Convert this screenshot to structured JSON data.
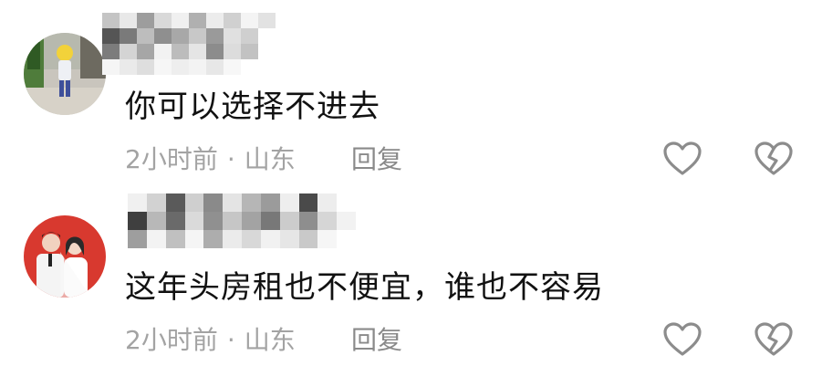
{
  "comments": [
    {
      "username": "",
      "text": "你可以选择不进去",
      "time": "2小时前",
      "separator": "·",
      "location": "山东",
      "reply_label": "回复",
      "like_icon": "heart-outline-icon",
      "dislike_icon": "broken-heart-icon"
    },
    {
      "username": "",
      "text": "这年头房租也不便宜，谁也不容易",
      "time": "2小时前",
      "separator": "·",
      "location": "山东",
      "reply_label": "回复",
      "like_icon": "heart-outline-icon",
      "dislike_icon": "broken-heart-icon"
    }
  ],
  "colors": {
    "text_primary": "#111111",
    "text_meta": "#a3a3a3",
    "icon_stroke": "#8c8c8c",
    "avatar2_bg": "#d8392f"
  }
}
